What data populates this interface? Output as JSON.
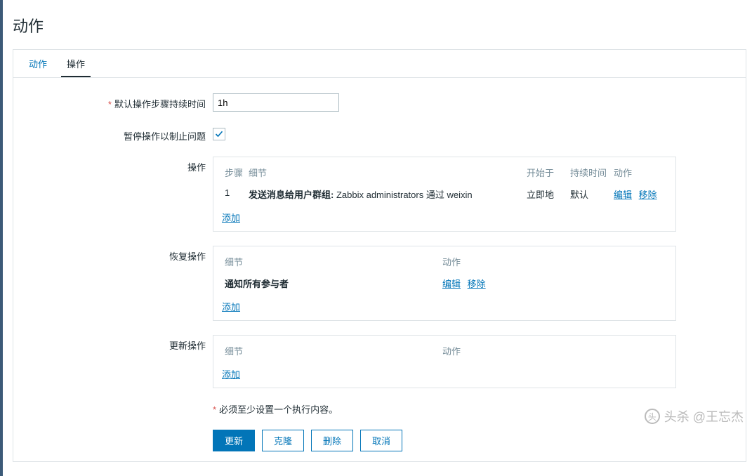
{
  "pageTitle": "动作",
  "tabs": {
    "action": "动作",
    "operation": "操作"
  },
  "form": {
    "durationLabel": "默认操作步骤持续时间",
    "durationValue": "1h",
    "pauseLabel": "暂停操作以制止问题"
  },
  "opsSection": {
    "label": "操作",
    "headers": {
      "step": "步骤",
      "detail": "细节",
      "start": "开始于",
      "duration": "持续时间",
      "action": "动作"
    },
    "row": {
      "step": "1",
      "detailPrefix": "发送消息给用户群组:",
      "detailRest": " Zabbix administrators 通过 weixin",
      "start": "立即地",
      "duration": "默认"
    },
    "add": "添加",
    "edit": "编辑",
    "remove": "移除"
  },
  "recoverySection": {
    "label": "恢复操作",
    "headers": {
      "detail": "细节",
      "action": "动作"
    },
    "row": {
      "detail": "通知所有参与者"
    },
    "add": "添加",
    "edit": "编辑",
    "remove": "移除"
  },
  "updateSection": {
    "label": "更新操作",
    "headers": {
      "detail": "细节",
      "action": "动作"
    },
    "add": "添加"
  },
  "hint": "必须至少设置一个执行内容。",
  "buttons": {
    "update": "更新",
    "clone": "克隆",
    "delete": "删除",
    "cancel": "取消"
  },
  "watermark": "头杀 @王忘杰"
}
